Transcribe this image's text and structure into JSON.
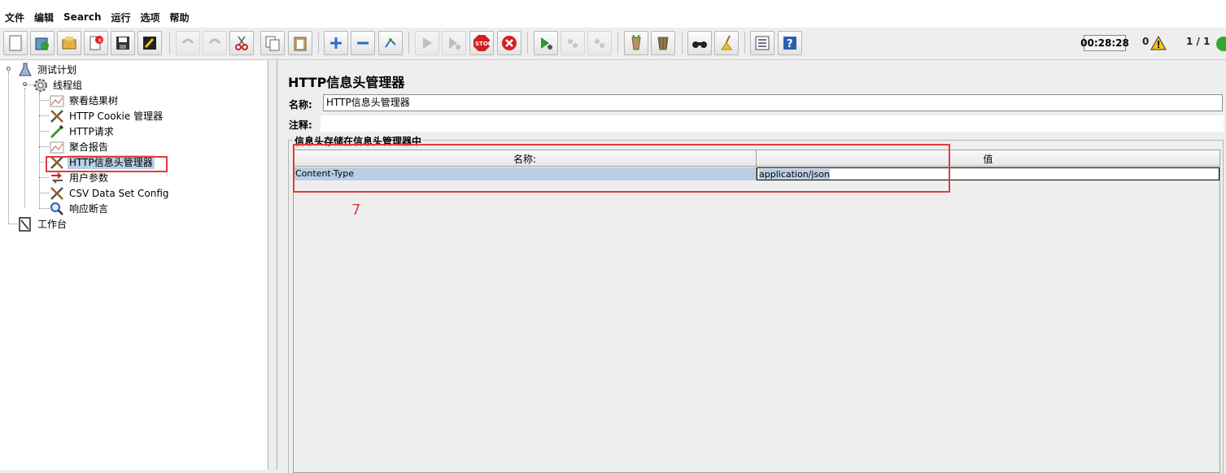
{
  "menu": [
    "文件",
    "编辑",
    "Search",
    "运行",
    "选项",
    "帮助"
  ],
  "toolbar": {
    "timer": "00:28:28",
    "warning_count": "0",
    "thread_ratio": "1 / 1",
    "buttons": [
      "new-icon",
      "templates-icon",
      "open-icon",
      "close-icon",
      "save-icon",
      "save-as-icon",
      "undo-icon",
      "redo-icon",
      "cut-icon",
      "copy-icon",
      "paste-icon",
      "expand-icon",
      "collapse-icon",
      "toggle-icon",
      "start-icon",
      "start-no-timers-icon",
      "stop-icon",
      "shutdown-icon",
      "remote-start-icon",
      "remote-stop-icon",
      "remote-shutdown-icon",
      "clear-icon",
      "clear-all-icon",
      "search-icon",
      "reset-search-icon",
      "function-helper-icon",
      "help-icon"
    ]
  },
  "tree": {
    "test_plan": "测试计划",
    "thread_group": "线程组",
    "items": [
      {
        "label": "察看结果树",
        "icon": "graph-icon"
      },
      {
        "label": "HTTP Cookie 管理器",
        "icon": "tools-icon"
      },
      {
        "label": "HTTP请求",
        "icon": "pipette-icon"
      },
      {
        "label": "聚合报告",
        "icon": "graph-icon"
      },
      {
        "label": "HTTP信息头管理器",
        "icon": "tools-icon",
        "selected": true
      },
      {
        "label": "用户参数",
        "icon": "arrow-icon"
      },
      {
        "label": "CSV Data Set Config",
        "icon": "tools-icon"
      },
      {
        "label": "响应断言",
        "icon": "magnifier-icon"
      }
    ],
    "workbench": "工作台"
  },
  "panel": {
    "title": "HTTP信息头管理器",
    "name_label": "名称:",
    "name_value": "HTTP信息头管理器",
    "comment_label": "注释:",
    "comment_value": "",
    "group_title": "信息头存储在信息头管理器中",
    "table": {
      "headers": [
        "名称:",
        "值"
      ],
      "rows": [
        {
          "name": "Content-Type",
          "value": "application/json"
        }
      ]
    }
  },
  "annotation": "7",
  "colors": {
    "selection": "#b8cfe5",
    "annotation_red": "#e53a3a"
  }
}
